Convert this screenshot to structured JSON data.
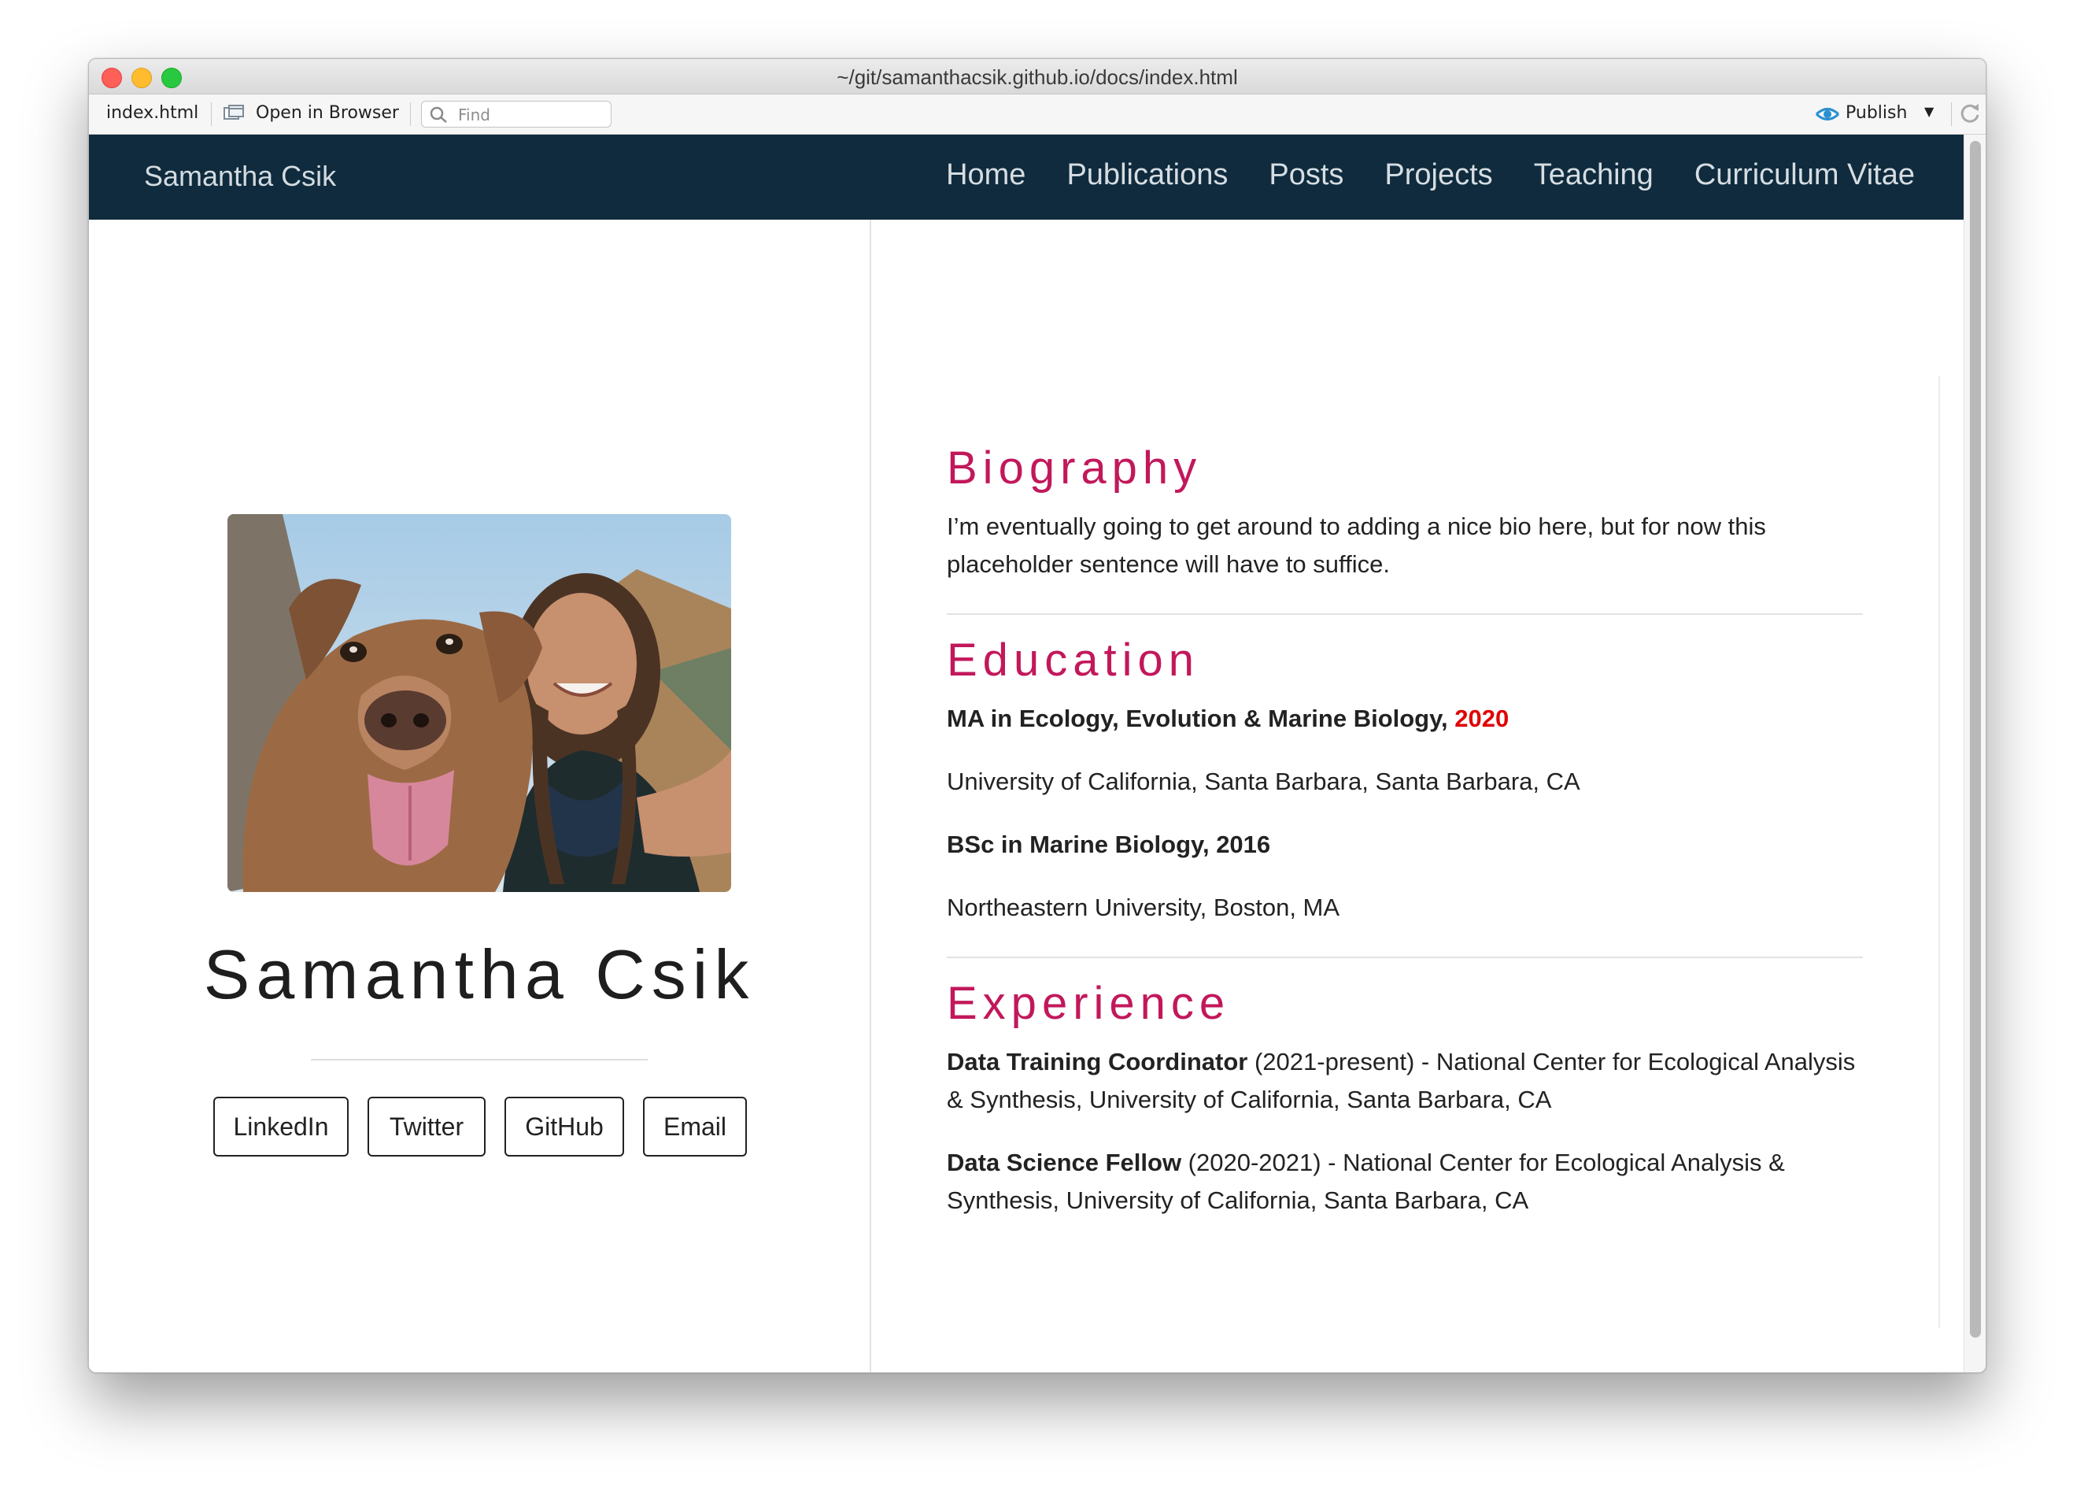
{
  "window": {
    "title": "~/git/samanthacsik.github.io/docs/index.html"
  },
  "toolbar": {
    "file_tab": "index.html",
    "open_in_browser": "Open in Browser",
    "find_placeholder": "Find",
    "publish": "Publish"
  },
  "navbar": {
    "brand": "Samantha Csik",
    "links": [
      "Home",
      "Publications",
      "Posts",
      "Projects",
      "Teaching",
      "Curriculum Vitae"
    ]
  },
  "profile": {
    "name": "Samantha Csik",
    "photo": "photo of a smiling woman with a brown dog outdoors in the mountains",
    "buttons": [
      "LinkedIn",
      "Twitter",
      "GitHub",
      "Email"
    ]
  },
  "biography": {
    "heading": "Biography",
    "text": "I’m eventually going to get around to adding a nice bio here, but for now this placeholder sentence will have to suffice."
  },
  "education": {
    "heading": "Education",
    "items": [
      {
        "degree": "MA in Ecology, Evolution & Marine Biology,",
        "year": "2020",
        "school": "University of California, Santa Barbara, Santa Barbara, CA"
      },
      {
        "degree": "BSc in Marine Biology, 2016",
        "school": "Northeastern University, Boston, MA"
      }
    ]
  },
  "experience": {
    "heading": "Experience",
    "items": [
      {
        "role": "Data Training Coordinator",
        "detail": " (2021-present) - National Center for Ecological Analysis & Synthesis, University of California, Santa Barbara, CA"
      },
      {
        "role": "Data Science Fellow",
        "detail": " (2020-2021) - National Center for Ecological Analysis & Synthesis, University of California, Santa Barbara, CA"
      }
    ]
  },
  "colors": {
    "navbar_bg": "#0f2b3d",
    "heading_accent": "#c2185b",
    "year_highlight": "#e00000"
  }
}
